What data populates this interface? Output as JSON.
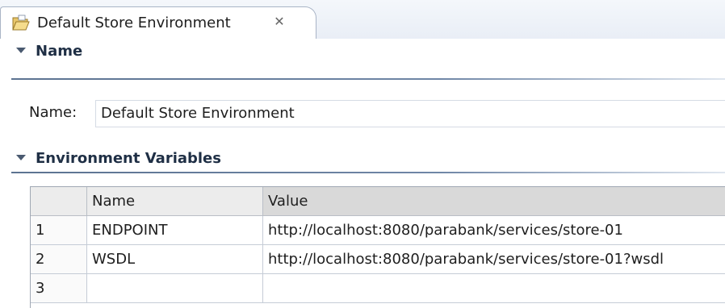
{
  "tab": {
    "title": "Default Store Environment",
    "icon": "folder-open-icon",
    "close_icon": "close-icon"
  },
  "sections": {
    "name": {
      "title": "Name"
    },
    "env": {
      "title": "Environment Variables"
    }
  },
  "name_field": {
    "label": "Name:",
    "value": "Default Store Environment"
  },
  "table": {
    "columns": [
      "",
      "Name",
      "Value"
    ],
    "rows": [
      {
        "num": "1",
        "name": "ENDPOINT",
        "value": "http://localhost:8080/parabank/services/store-01"
      },
      {
        "num": "2",
        "name": "WSDL",
        "value": "http://localhost:8080/parabank/services/store-01?wsdl"
      },
      {
        "num": "3",
        "name": "",
        "value": ""
      }
    ]
  },
  "colors": {
    "section_title": "#1f2f45",
    "rule": "#5c7391",
    "header_bg": "#ececec"
  }
}
